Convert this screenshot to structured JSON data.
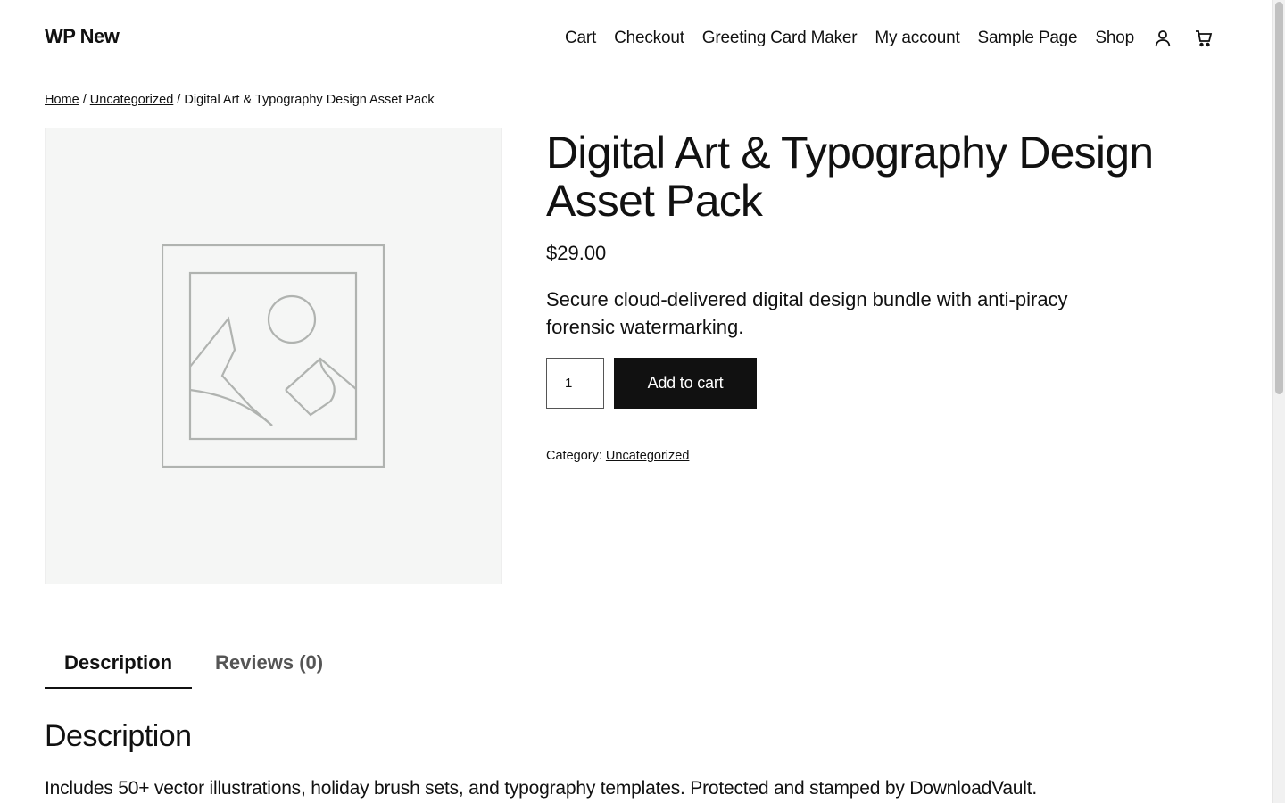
{
  "header": {
    "site_title": "WP New",
    "nav": [
      "Cart",
      "Checkout",
      "Greeting Card Maker",
      "My account",
      "Sample Page",
      "Shop"
    ],
    "icons": [
      "account-icon",
      "cart-icon"
    ]
  },
  "breadcrumb": {
    "home": "Home",
    "sep1": " / ",
    "category": "Uncategorized",
    "sep2": " / ",
    "current": "Digital Art & Typography Design Asset Pack"
  },
  "product": {
    "title": "Digital Art & Typography Design Asset Pack",
    "price": "$29.00",
    "short_description": "Secure cloud-delivered digital design bundle with anti-piracy forensic watermarking.",
    "quantity": "1",
    "add_to_cart_label": "Add to cart",
    "category_label": "Category: ",
    "category": "Uncategorized",
    "image_icon": "image-placeholder-icon"
  },
  "tabs": {
    "description": "Description",
    "reviews": "Reviews (0)"
  },
  "description_section": {
    "heading": "Description",
    "text": "Includes 50+ vector illustrations, holiday brush sets, and typography templates. Protected and stamped by DownloadVault."
  },
  "colors": {
    "button_bg": "#111111",
    "image_bg": "#f5f6f5",
    "placeholder_stroke": "#b0b3b0"
  }
}
